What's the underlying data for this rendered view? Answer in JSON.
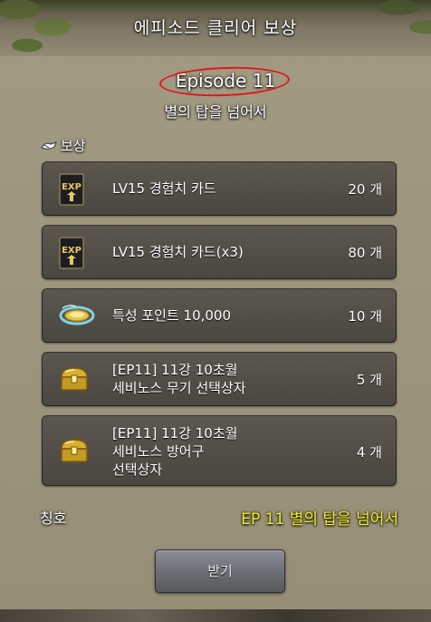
{
  "header": {
    "title": "에피소드 클리어 보상"
  },
  "episode": {
    "label": "Episode 11",
    "subtitle": "별의 탑을 넘어서"
  },
  "rewards": {
    "section_label": "보상",
    "items": [
      {
        "icon": "exp-card-icon",
        "name_lines": [
          "LV15 경험치 카드"
        ],
        "qty": "20 개"
      },
      {
        "icon": "exp-card-icon",
        "name_lines": [
          "LV15 경험치 카드(x3)"
        ],
        "qty": "80 개"
      },
      {
        "icon": "trait-point-icon",
        "name_lines": [
          "특성 포인트 10,000"
        ],
        "qty": "10 개"
      },
      {
        "icon": "treasure-chest-icon",
        "name_lines": [
          "[EP11] 11강 10초월",
          "세비노스 무기 선택상자"
        ],
        "qty": "5 개"
      },
      {
        "icon": "treasure-chest-icon",
        "name_lines": [
          "[EP11] 11강 10초월",
          "세비노스 방어구",
          "선택상자"
        ],
        "qty": "4 개"
      }
    ]
  },
  "title_reward": {
    "label": "칭호",
    "value": "EP 11 별의 탑을 넘어서"
  },
  "receive_button": {
    "label": "받기"
  },
  "colors": {
    "title_value": "#f2ee20",
    "annotation_ellipse": "#e01818"
  }
}
